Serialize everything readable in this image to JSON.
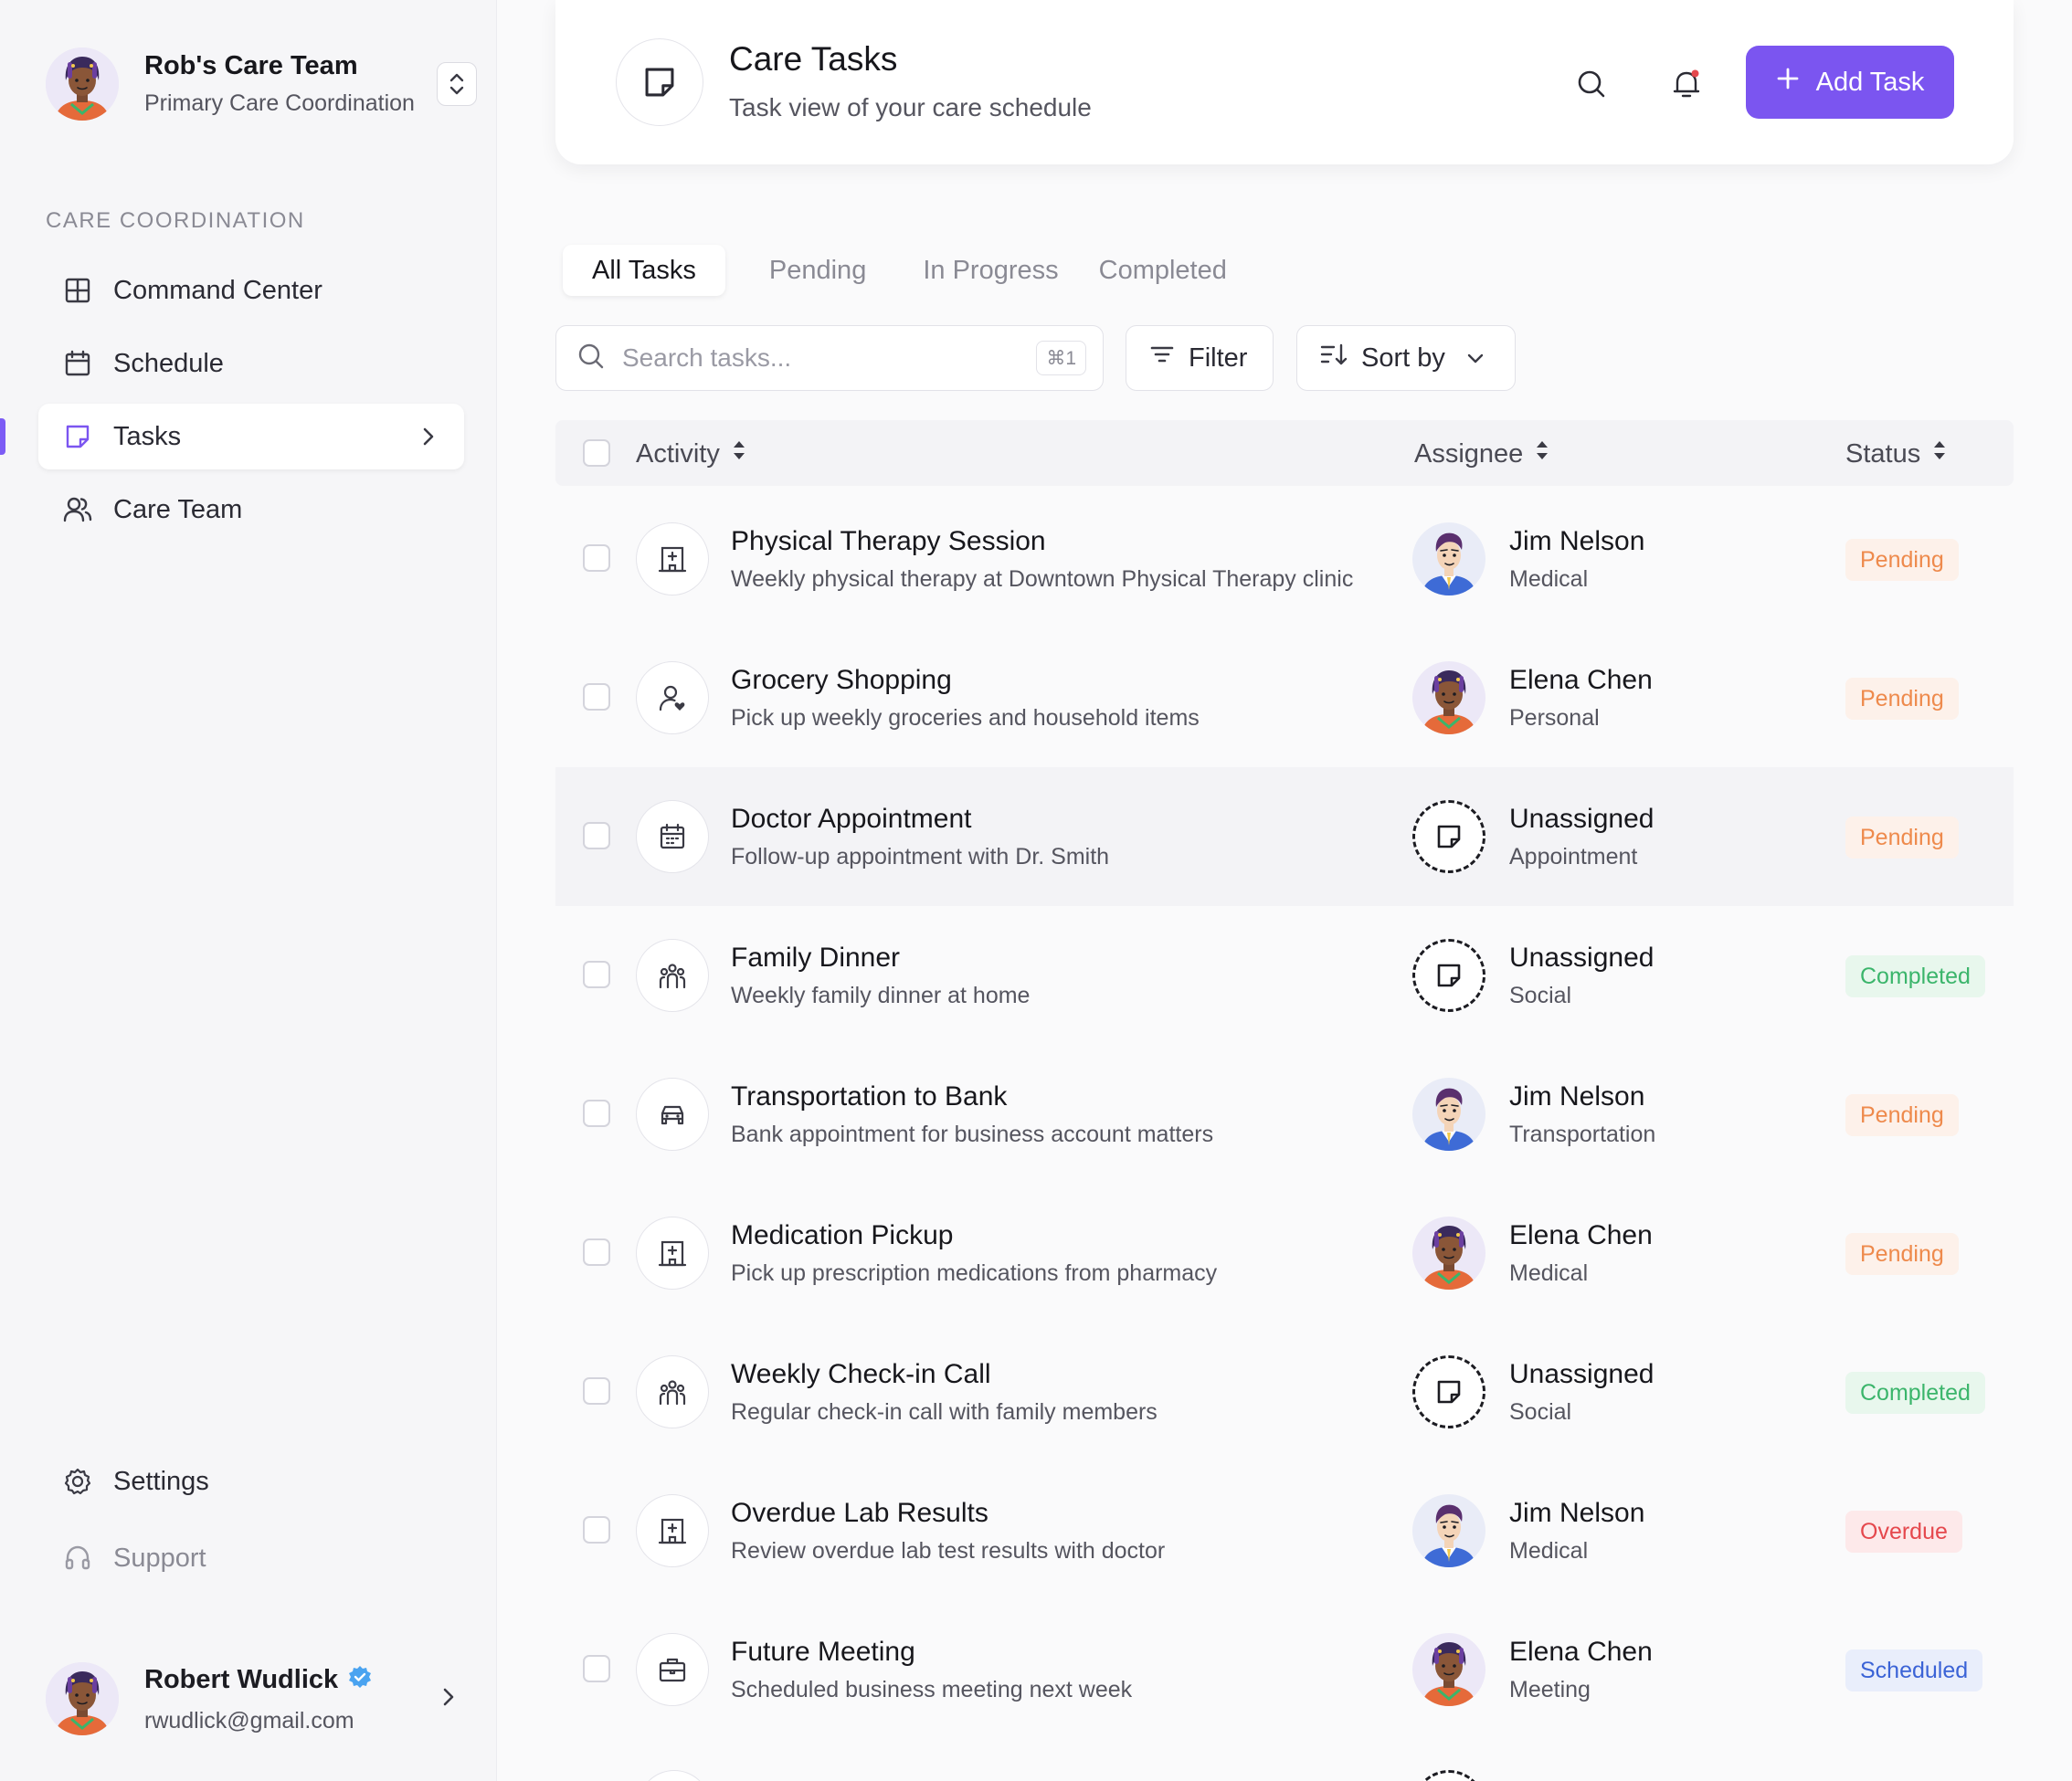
{
  "colors": {
    "accent": "#7b55f0",
    "pending": "#ee8a4c",
    "completed": "#3bb56b",
    "overdue": "#e5484d",
    "scheduled": "#3b63d6"
  },
  "sidebar": {
    "team_name": "Rob's Care Team",
    "team_subtitle": "Primary Care Coordination",
    "section_label": "CARE COORDINATION",
    "items": [
      {
        "label": "Command Center",
        "icon": "grid-icon"
      },
      {
        "label": "Schedule",
        "icon": "calendar-icon"
      },
      {
        "label": "Tasks",
        "icon": "sticky-note-icon",
        "active": true
      },
      {
        "label": "Care Team",
        "icon": "users-icon"
      }
    ],
    "settings_label": "Settings",
    "support_label": "Support",
    "user": {
      "name": "Robert Wudlick",
      "email": "rwudlick@gmail.com",
      "verified": true
    }
  },
  "header": {
    "title": "Care Tasks",
    "subtitle": "Task view of your care schedule",
    "add_button": "Add Task"
  },
  "tabs": [
    "All Tasks",
    "Pending",
    "In Progress",
    "Completed"
  ],
  "toolbar": {
    "search_placeholder": "Search tasks...",
    "search_shortcut": "⌘1",
    "filter_label": "Filter",
    "sort_label": "Sort by"
  },
  "table": {
    "columns": {
      "activity": "Activity",
      "assignee": "Assignee",
      "status": "Status"
    },
    "rows": [
      {
        "title": "Physical Therapy Session",
        "description": "Weekly physical therapy at Downtown Physical Therapy clinic",
        "icon": "hospital-icon",
        "assignee": "Jim Nelson",
        "category": "Medical",
        "avatar": "jim",
        "status": "Pending",
        "status_kind": "pending"
      },
      {
        "title": "Grocery Shopping",
        "description": "Pick up weekly groceries and household items",
        "icon": "person-heart-icon",
        "assignee": "Elena Chen",
        "category": "Personal",
        "avatar": "elena",
        "status": "Pending",
        "status_kind": "pending"
      },
      {
        "title": "Doctor Appointment",
        "description": "Follow-up appointment with Dr. Smith",
        "icon": "calendar-icon",
        "assignee": "Unassigned",
        "category": "Appointment",
        "avatar": "unassigned",
        "status": "Pending",
        "status_kind": "pending",
        "highlighted": true
      },
      {
        "title": "Family Dinner",
        "description": "Weekly family dinner at home",
        "icon": "family-icon",
        "assignee": "Unassigned",
        "category": "Social",
        "avatar": "unassigned",
        "status": "Completed",
        "status_kind": "completed"
      },
      {
        "title": "Transportation to Bank",
        "description": "Bank appointment for business account matters",
        "icon": "car-icon",
        "assignee": "Jim Nelson",
        "category": "Transportation",
        "avatar": "jim",
        "status": "Pending",
        "status_kind": "pending"
      },
      {
        "title": "Medication Pickup",
        "description": "Pick up prescription medications from pharmacy",
        "icon": "hospital-icon",
        "assignee": "Elena Chen",
        "category": "Medical",
        "avatar": "elena",
        "status": "Pending",
        "status_kind": "pending"
      },
      {
        "title": "Weekly Check-in Call",
        "description": "Regular check-in call with family members",
        "icon": "family-icon",
        "assignee": "Unassigned",
        "category": "Social",
        "avatar": "unassigned",
        "status": "Completed",
        "status_kind": "completed"
      },
      {
        "title": "Overdue Lab Results",
        "description": "Review overdue lab test results with doctor",
        "icon": "hospital-icon",
        "assignee": "Jim Nelson",
        "category": "Medical",
        "avatar": "jim",
        "status": "Overdue",
        "status_kind": "overdue"
      },
      {
        "title": "Future Meeting",
        "description": "Scheduled business meeting next week",
        "icon": "briefcase-icon",
        "assignee": "Elena Chen",
        "category": "Meeting",
        "avatar": "elena",
        "status": "Scheduled",
        "status_kind": "scheduled"
      }
    ]
  }
}
